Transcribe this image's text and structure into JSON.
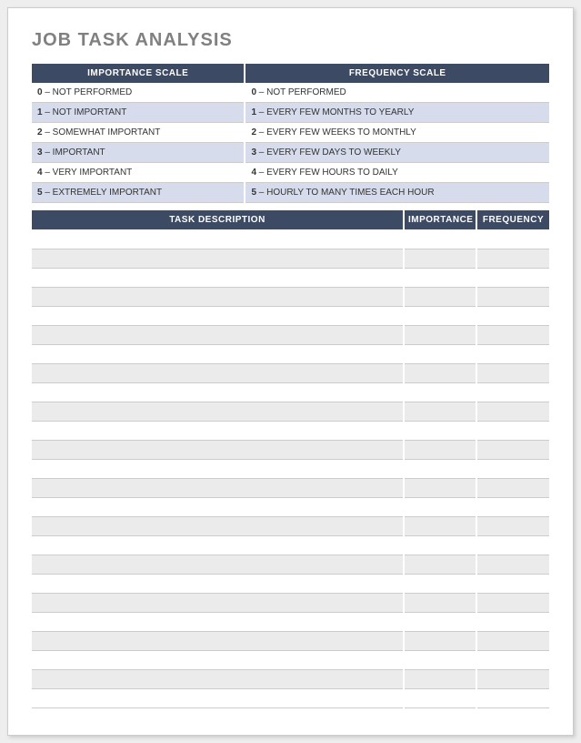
{
  "title": "JOB TASK ANALYSIS",
  "scales": {
    "importance": {
      "header": "IMPORTANCE SCALE",
      "rows": [
        {
          "num": "0",
          "label": " – NOT PERFORMED"
        },
        {
          "num": "1",
          "label": " – NOT IMPORTANT"
        },
        {
          "num": "2",
          "label": " – SOMEWHAT IMPORTANT"
        },
        {
          "num": "3",
          "label": " – IMPORTANT"
        },
        {
          "num": "4",
          "label": " – VERY IMPORTANT"
        },
        {
          "num": "5",
          "label": " – EXTREMELY IMPORTANT"
        }
      ]
    },
    "frequency": {
      "header": "FREQUENCY SCALE",
      "rows": [
        {
          "num": "0",
          "label": " – NOT PERFORMED"
        },
        {
          "num": "1",
          "label": " – EVERY FEW MONTHS TO YEARLY"
        },
        {
          "num": "2",
          "label": " – EVERY FEW WEEKS TO MONTHLY"
        },
        {
          "num": "3",
          "label": " – EVERY FEW DAYS TO WEEKLY"
        },
        {
          "num": "4",
          "label": " – EVERY FEW HOURS TO DAILY"
        },
        {
          "num": "5",
          "label": " – HOURLY TO MANY TIMES EACH HOUR"
        }
      ]
    }
  },
  "tasks": {
    "headers": {
      "description": "TASK DESCRIPTION",
      "importance": "IMPORTANCE",
      "frequency": "FREQUENCY"
    },
    "rows": [
      {
        "description": "",
        "importance": "",
        "frequency": ""
      },
      {
        "description": "",
        "importance": "",
        "frequency": ""
      },
      {
        "description": "",
        "importance": "",
        "frequency": ""
      },
      {
        "description": "",
        "importance": "",
        "frequency": ""
      },
      {
        "description": "",
        "importance": "",
        "frequency": ""
      },
      {
        "description": "",
        "importance": "",
        "frequency": ""
      },
      {
        "description": "",
        "importance": "",
        "frequency": ""
      },
      {
        "description": "",
        "importance": "",
        "frequency": ""
      },
      {
        "description": "",
        "importance": "",
        "frequency": ""
      },
      {
        "description": "",
        "importance": "",
        "frequency": ""
      },
      {
        "description": "",
        "importance": "",
        "frequency": ""
      },
      {
        "description": "",
        "importance": "",
        "frequency": ""
      },
      {
        "description": "",
        "importance": "",
        "frequency": ""
      },
      {
        "description": "",
        "importance": "",
        "frequency": ""
      },
      {
        "description": "",
        "importance": "",
        "frequency": ""
      },
      {
        "description": "",
        "importance": "",
        "frequency": ""
      },
      {
        "description": "",
        "importance": "",
        "frequency": ""
      },
      {
        "description": "",
        "importance": "",
        "frequency": ""
      },
      {
        "description": "",
        "importance": "",
        "frequency": ""
      },
      {
        "description": "",
        "importance": "",
        "frequency": ""
      },
      {
        "description": "",
        "importance": "",
        "frequency": ""
      },
      {
        "description": "",
        "importance": "",
        "frequency": ""
      },
      {
        "description": "",
        "importance": "",
        "frequency": ""
      },
      {
        "description": "",
        "importance": "",
        "frequency": ""
      },
      {
        "description": "",
        "importance": "",
        "frequency": ""
      }
    ]
  }
}
